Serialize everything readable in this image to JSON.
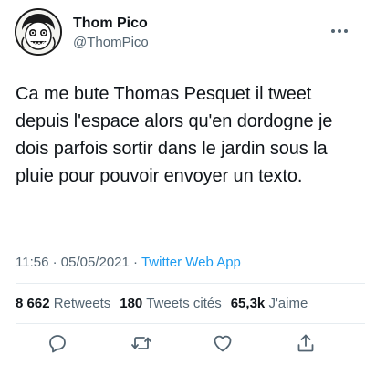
{
  "author": {
    "display_name": "Thom Pico",
    "handle": "@ThomPico"
  },
  "tweet": {
    "text": "Ca me bute Thomas Pesquet il tweet depuis l'espace alors qu'en dordogne je dois parfois sortir dans le jardin sous la pluie pour pouvoir envoyer un texto.",
    "time": "11:56",
    "date": "05/05/2021",
    "separator": "·",
    "source": "Twitter Web App"
  },
  "stats": {
    "retweets_count": "8 662",
    "retweets_label": "Retweets",
    "quotes_count": "180",
    "quotes_label": "Tweets cités",
    "likes_count": "65,3k",
    "likes_label": "J'aime"
  },
  "actions": {
    "reply_icon": "reply-icon",
    "retweet_icon": "retweet-icon",
    "like_icon": "heart-icon",
    "share_icon": "share-icon"
  },
  "colors": {
    "text": "#0f1419",
    "secondary": "#536471",
    "link": "#1d9bf0",
    "divider": "#e6ecf0"
  }
}
